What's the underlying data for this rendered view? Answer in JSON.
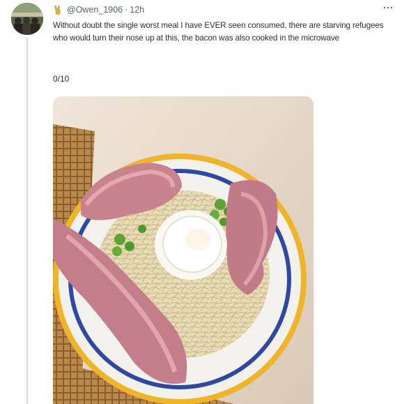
{
  "tweet": {
    "avatar_icon": "user-avatar-photo",
    "badge_icon": "victory-hand-icon",
    "handle": "@Owen_1906",
    "separator": "·",
    "timestamp": "12h",
    "more_icon": "more-options-icon",
    "text": "Without doubt the single worst meal I have EVER seen consumed, there are starving refugees who would turn their nose up at this, the bacon was also cooked in the microwave",
    "rating": "0/10"
  },
  "media": {
    "description_icon": "photo-plate-spaghetti-bacon-egg-peas"
  },
  "colors": {
    "text": "#2b2f33",
    "secondary_text": "#536471",
    "thread_line": "#cfd9de",
    "plate_rim_blue": "#2f49a3",
    "plate_rim_yellow": "#f0b429"
  }
}
